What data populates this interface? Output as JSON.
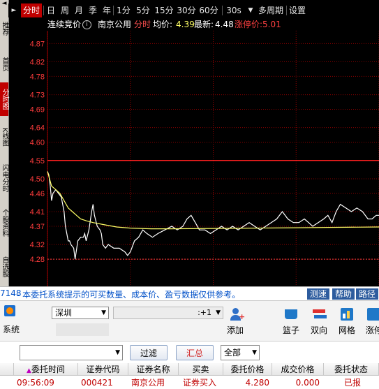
{
  "sidebar": {
    "items": [
      {
        "label": "推荐",
        "active": false
      },
      {
        "label": "首页",
        "active": false
      },
      {
        "label": "分时图",
        "active": true
      },
      {
        "label": "K线图",
        "active": false
      },
      {
        "label": "闪电分时",
        "active": false
      },
      {
        "label": "个股资料",
        "active": false
      },
      {
        "label": "自选股",
        "active": false
      }
    ],
    "nav_arrows": [
      "◄",
      "►"
    ]
  },
  "period_tabs": [
    "分时",
    "日",
    "周",
    "月",
    "季",
    "年",
    "1分",
    "5分",
    "15分",
    "30分",
    "60分",
    "30s",
    "多周期",
    "设置"
  ],
  "active_period": "分时",
  "dropdown_caret": "▼",
  "info": {
    "auction_label": "连续竞价",
    "info_icon": "info-circle-icon",
    "stock_name": "南京公用",
    "mode": "分时",
    "avg_label": "均价:",
    "avg_value": "4.39",
    "latest_label": "最新:",
    "latest_value": "4.48",
    "limit_label": "涨停价:",
    "limit_value": "5.01"
  },
  "chart_data": {
    "type": "line",
    "title": "",
    "ylim": [
      4.24,
      4.905
    ],
    "y_ticks": [
      4.87,
      4.82,
      4.78,
      4.73,
      4.69,
      4.64,
      4.6,
      4.55,
      4.5,
      4.46,
      4.41,
      4.37,
      4.32,
      4.28
    ],
    "reference_price": 4.55,
    "lower_limit_dotted": 4.28,
    "x_range": [
      0,
      240
    ],
    "vertical_grid_x": [
      0,
      60,
      120,
      180,
      240
    ],
    "series": [
      {
        "name": "price",
        "color": "#ffffff",
        "points": [
          [
            0,
            4.52
          ],
          [
            1,
            4.51
          ],
          [
            2,
            4.48
          ],
          [
            3,
            4.44
          ],
          [
            4,
            4.46
          ],
          [
            6,
            4.47
          ],
          [
            8,
            4.46
          ],
          [
            10,
            4.45
          ],
          [
            12,
            4.41
          ],
          [
            13,
            4.37
          ],
          [
            14,
            4.35
          ],
          [
            15,
            4.33
          ],
          [
            16,
            4.33
          ],
          [
            17,
            4.32
          ],
          [
            19,
            4.31
          ],
          [
            20,
            4.28
          ],
          [
            22,
            4.33
          ],
          [
            24,
            4.34
          ],
          [
            26,
            4.34
          ],
          [
            27,
            4.35
          ],
          [
            28,
            4.33
          ],
          [
            30,
            4.36
          ],
          [
            32,
            4.41
          ],
          [
            33,
            4.43
          ],
          [
            34,
            4.4
          ],
          [
            36,
            4.37
          ],
          [
            38,
            4.36
          ],
          [
            39,
            4.35
          ],
          [
            40,
            4.32
          ],
          [
            42,
            4.31
          ],
          [
            44,
            4.32
          ],
          [
            48,
            4.31
          ],
          [
            52,
            4.31
          ],
          [
            56,
            4.3
          ],
          [
            58,
            4.29
          ],
          [
            60,
            4.3
          ],
          [
            63,
            4.33
          ],
          [
            66,
            4.34
          ],
          [
            69,
            4.36
          ],
          [
            72,
            4.35
          ],
          [
            76,
            4.34
          ],
          [
            80,
            4.35
          ],
          [
            85,
            4.36
          ],
          [
            90,
            4.37
          ],
          [
            94,
            4.36
          ],
          [
            98,
            4.37
          ],
          [
            101,
            4.39
          ],
          [
            104,
            4.4
          ],
          [
            107,
            4.38
          ],
          [
            110,
            4.36
          ],
          [
            114,
            4.36
          ],
          [
            118,
            4.35
          ],
          [
            122,
            4.36
          ],
          [
            126,
            4.37
          ],
          [
            130,
            4.36
          ],
          [
            134,
            4.37
          ],
          [
            138,
            4.36
          ],
          [
            142,
            4.37
          ],
          [
            146,
            4.38
          ],
          [
            150,
            4.37
          ],
          [
            154,
            4.36
          ],
          [
            158,
            4.37
          ],
          [
            162,
            4.38
          ],
          [
            166,
            4.39
          ],
          [
            170,
            4.41
          ],
          [
            174,
            4.39
          ],
          [
            178,
            4.38
          ],
          [
            182,
            4.38
          ],
          [
            186,
            4.39
          ],
          [
            189,
            4.38
          ],
          [
            192,
            4.37
          ],
          [
            196,
            4.38
          ],
          [
            200,
            4.39
          ],
          [
            203,
            4.4
          ],
          [
            206,
            4.38
          ],
          [
            209,
            4.41
          ],
          [
            212,
            4.43
          ],
          [
            216,
            4.42
          ],
          [
            220,
            4.41
          ],
          [
            224,
            4.42
          ],
          [
            228,
            4.41
          ],
          [
            232,
            4.39
          ],
          [
            235,
            4.39
          ],
          [
            238,
            4.4
          ],
          [
            240,
            4.4
          ]
        ]
      },
      {
        "name": "avg",
        "color": "#ffff66",
        "points": [
          [
            0,
            4.52
          ],
          [
            3,
            4.48
          ],
          [
            6,
            4.47
          ],
          [
            9,
            4.46
          ],
          [
            12,
            4.44
          ],
          [
            15,
            4.42
          ],
          [
            18,
            4.41
          ],
          [
            21,
            4.4
          ],
          [
            24,
            4.39
          ],
          [
            28,
            4.385
          ],
          [
            33,
            4.38
          ],
          [
            40,
            4.375
          ],
          [
            50,
            4.368
          ],
          [
            60,
            4.365
          ],
          [
            75,
            4.363
          ],
          [
            90,
            4.363
          ],
          [
            120,
            4.364
          ],
          [
            150,
            4.365
          ],
          [
            180,
            4.366
          ],
          [
            210,
            4.367
          ],
          [
            240,
            4.368
          ]
        ]
      }
    ]
  },
  "notice": {
    "prefix": "7148",
    "text": " - 本委托系统提示的可买数量、成本价、盈亏数据仅供参考。",
    "buttons": [
      "测速",
      "帮助",
      "路径"
    ]
  },
  "toolbar": {
    "system_label": "系统",
    "market_select": "深圳",
    "account_suffix": ":+1",
    "add_label": "添加",
    "basket_label": "篮子",
    "two_way_label": "双向",
    "grid_label": "网格",
    "cut_label": "涨停"
  },
  "filter": {
    "input_value": "",
    "filter_button": "过滤",
    "summary_button": "汇总",
    "all_select": "全部"
  },
  "table": {
    "columns": [
      "委托时间",
      "证券代码",
      "证券名称",
      "买卖",
      "委托价格",
      "成交价格",
      "委托状态"
    ],
    "sort_indicator": "▲",
    "rows": [
      [
        "09:56:09",
        "000421",
        "南京公用",
        "证券买入",
        "4.280",
        "0.000",
        "已报"
      ]
    ]
  },
  "colors": {
    "axis_red": "#c00000",
    "reference_line": "#ff2020",
    "grid_dotted": "#8b0000",
    "price_line": "#ffffff",
    "avg_line": "#ffff66",
    "tick_text": "#ff3c3c"
  }
}
